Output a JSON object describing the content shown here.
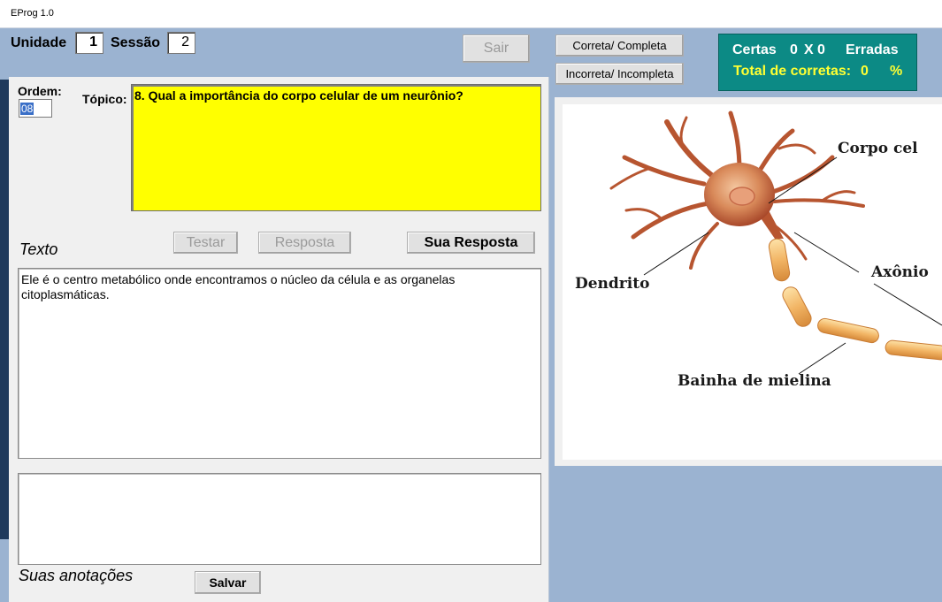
{
  "window": {
    "title": "EProg 1.0"
  },
  "header": {
    "unidade_label": "Unidade",
    "unidade_value": "1",
    "sessao_label": "Sessão",
    "sessao_value": "2",
    "sair_label": "Sair",
    "correta_label": "Correta/ Completa",
    "incorreta_label": "Incorreta/ Incompleta"
  },
  "score": {
    "certas_label": "Certas",
    "certas_value": "0",
    "separator": "X",
    "erradas_value": "0",
    "erradas_label": "Erradas",
    "total_label": "Total de corretas:",
    "total_value": "0",
    "percent": "%",
    "colors": {
      "panel": "#0c8a85",
      "row1": "#ffffff",
      "row2": "#ffff33"
    }
  },
  "question": {
    "ordem_label": "Ordem:",
    "ordem_value": "08",
    "topico_label": "Tópico:",
    "topico_text": "8. Qual a importância do corpo celular de um neurônio?",
    "topico_bg": "#ffff00"
  },
  "actions": {
    "texto_label": "Texto",
    "testar_label": "Testar",
    "resposta_label": "Resposta",
    "sua_resposta_label": "Sua Resposta"
  },
  "answer": {
    "text": "Ele é o centro metabólico onde encontramos o núcleo da célula e as organelas citoplasmáticas."
  },
  "notes": {
    "label": "Suas anotações",
    "value": "",
    "salvar_label": "Salvar"
  },
  "diagram": {
    "labels": {
      "corpo": "Corpo cel",
      "dendrito": "Dendrito",
      "axonio": "Axônio",
      "bainha": "Bainha de mielina"
    }
  }
}
